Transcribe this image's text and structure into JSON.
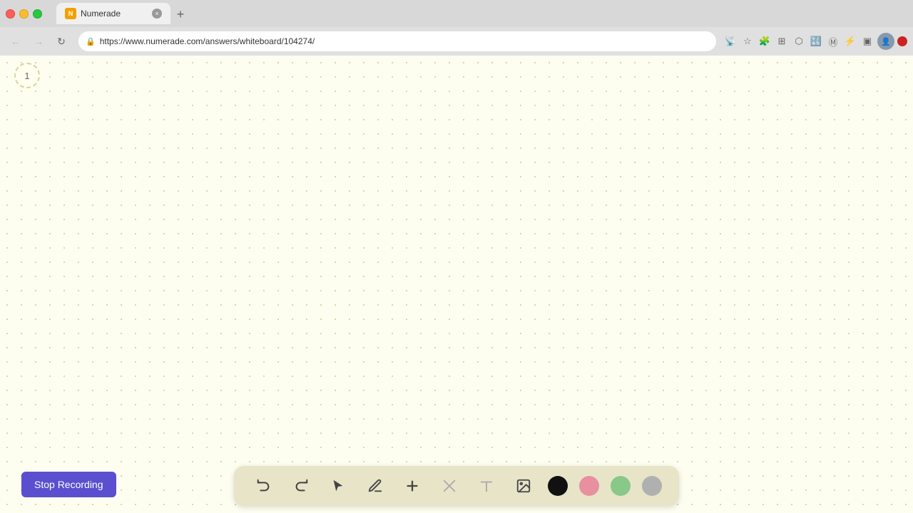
{
  "browser": {
    "tab_title": "Numerade",
    "tab_favicon_text": "N",
    "url": "https://www.numerade.com/answers/whiteboard/104274/",
    "close_label": "×",
    "new_tab_label": "+"
  },
  "toolbar": {
    "back_disabled": false,
    "forward_disabled": false,
    "reload_label": "↻",
    "lock_icon": "🔒"
  },
  "whiteboard": {
    "page_number": "1",
    "background_color": "#fefef0",
    "dot_color": "#c8c8a0"
  },
  "stop_recording": {
    "label": "Stop Recording",
    "bg_color": "#5b4fcf"
  },
  "bottom_toolbar": {
    "undo_label": "↺",
    "redo_label": "↻",
    "cursor_label": "▲",
    "pen_label": "✏",
    "plus_label": "+",
    "eraser_label": "/",
    "text_label": "A",
    "image_label": "🖼",
    "colors": [
      {
        "name": "black",
        "value": "#111111"
      },
      {
        "name": "pink",
        "value": "#e88fa0"
      },
      {
        "name": "green",
        "value": "#88c888"
      },
      {
        "name": "gray",
        "value": "#b0b0b0"
      }
    ]
  }
}
